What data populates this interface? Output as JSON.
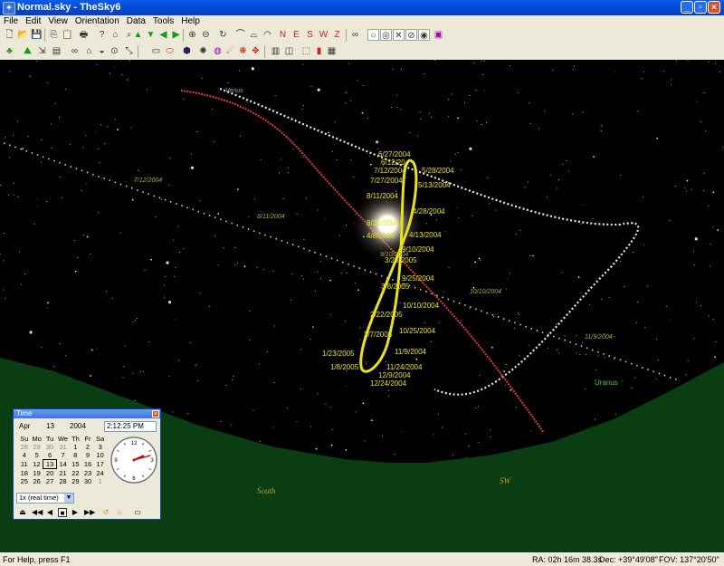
{
  "window": {
    "title": "Normal.sky - TheSky6"
  },
  "menu": [
    "File",
    "Edit",
    "View",
    "Orientation",
    "Data",
    "Tools",
    "Help"
  ],
  "sky": {
    "ecliptic_labels": [
      {
        "text": "7/12/2004"
      },
      {
        "text": "8/11/2004"
      },
      {
        "text": "9/10/2004"
      },
      {
        "text": "10/10/2004"
      },
      {
        "text": "11/9/2004"
      }
    ],
    "loop_dates": [
      "6/27/2004",
      "6/12/20..",
      "7/12/2004",
      "5/28/2004",
      "7/27/2004",
      "5/13/2004",
      "8/11/2004",
      "4/28/2004",
      "4/13/2004",
      "8/26/2004",
      "4/8/2005",
      "9/10/2004",
      "3/23/2005",
      "9/25/2004",
      "3/8/2005",
      "10/10/2004",
      "2/22/2005",
      "10/25/2004",
      "2/7/2005",
      "1/23/2005",
      "11/9/2004",
      "1/8/2005",
      "11/24/2004",
      "12/9/2004",
      "12/24/2004"
    ],
    "planet_labels": {
      "venus": "Venus",
      "uranus": "Uranus"
    },
    "horizon_labels": {
      "south": "South",
      "southwest": "SW"
    },
    "colors": {
      "ground": "#0a3d12",
      "loop_path": "#e8e020",
      "ecliptic_path": "#e03b3b",
      "venus_path": "#e8e8e8",
      "ecliptic_dots": "#d8d890",
      "uranus_label": "#3fc56a",
      "horizon_text": "#b79a3a"
    }
  },
  "time_window": {
    "title": "Time",
    "month": "Apr",
    "day": "13",
    "year": "2004",
    "clock_time": "2:12:25 PM",
    "weekdays": [
      "Su",
      "Mo",
      "Tu",
      "We",
      "Th",
      "Fr",
      "Sa"
    ],
    "calendar_rows": [
      [
        "28",
        "29",
        "30",
        "31",
        "1",
        "2",
        "3"
      ],
      [
        "4",
        "5",
        "6",
        "7",
        "8",
        "9",
        "10"
      ],
      [
        "11",
        "12",
        "13",
        "14",
        "15",
        "16",
        "17"
      ],
      [
        "18",
        "19",
        "20",
        "21",
        "22",
        "23",
        "24"
      ],
      [
        "25",
        "26",
        "27",
        "28",
        "29",
        "30",
        "1"
      ]
    ],
    "selected_day": "13",
    "clock_numerals": [
      "12",
      "3",
      "6",
      "9"
    ],
    "clock_time_hours": 14.2069,
    "speed": "1x (real time)"
  },
  "status_bar": {
    "help": "For Help, press F1",
    "ra": "RA: 02h 16m 38.3s",
    "dec": "Dec: +39°49'08\"",
    "fov": "FOV: 137°20'50\""
  }
}
